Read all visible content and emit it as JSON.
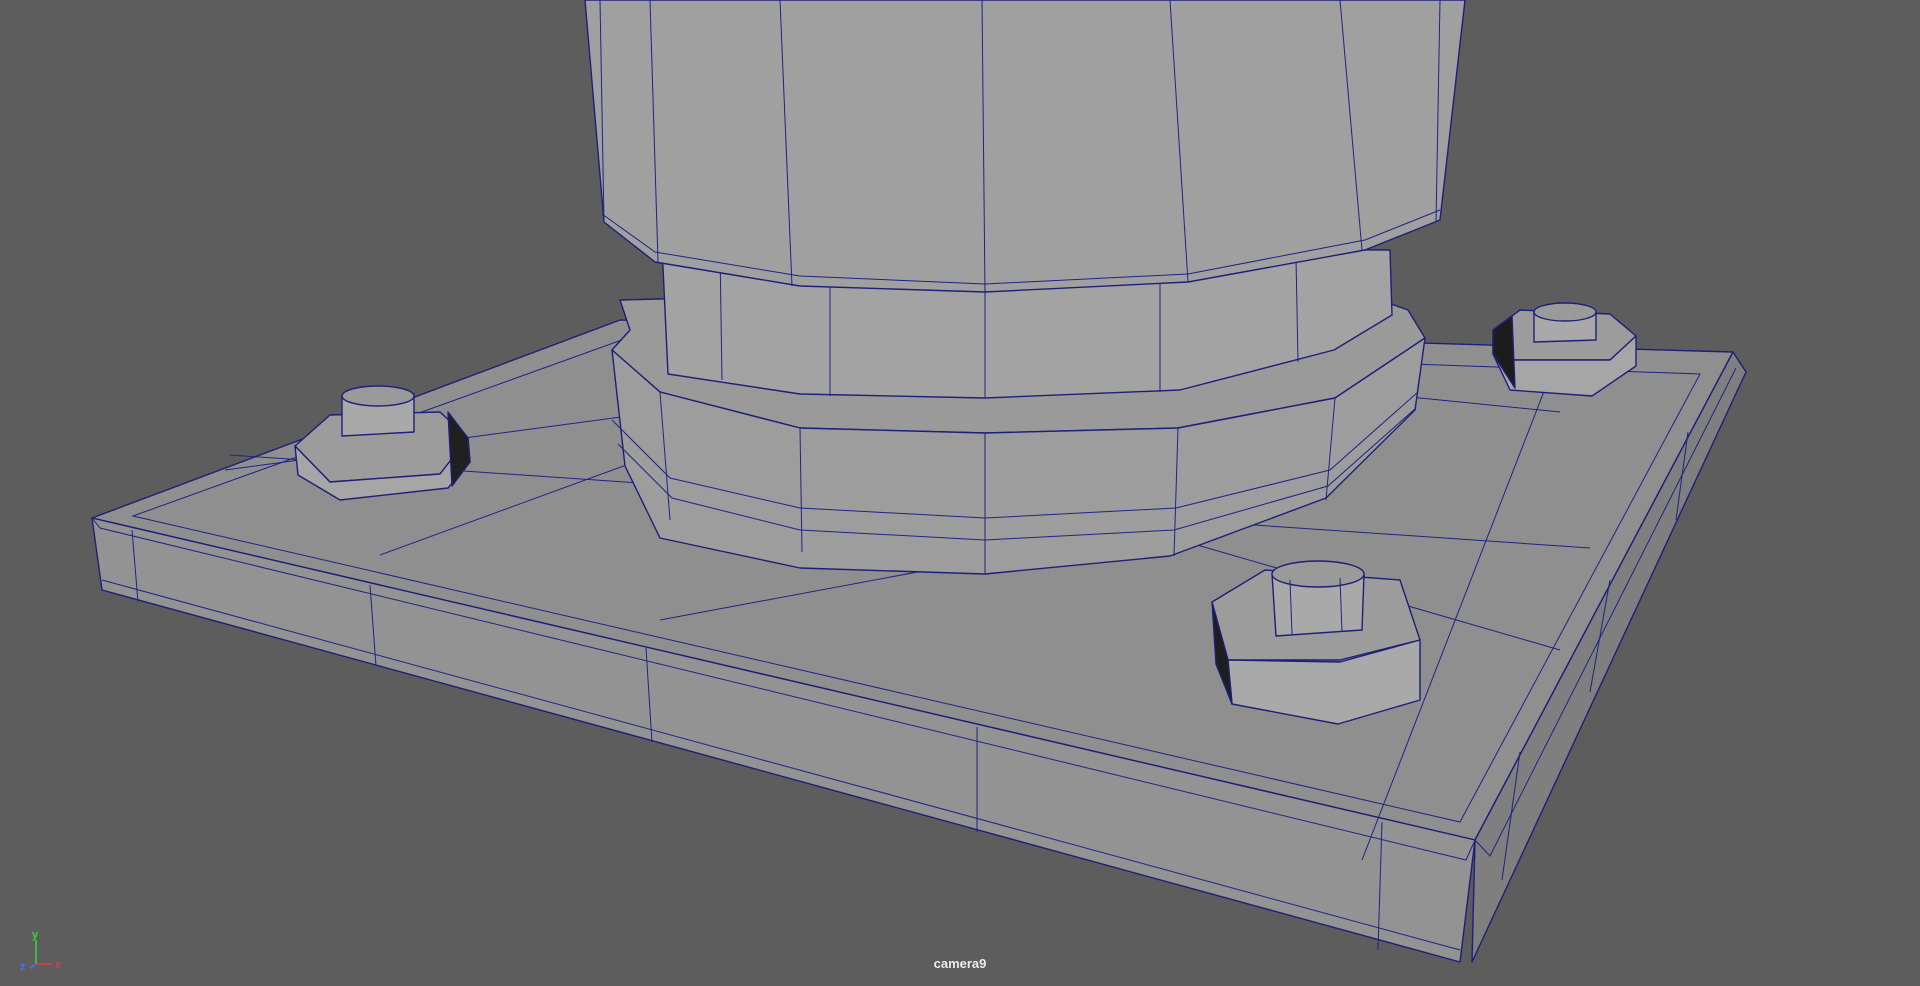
{
  "viewport": {
    "camera_name": "camera9",
    "background_color": "#5d5d5d",
    "wireframe_color": "#1d1f7a"
  },
  "axis_gizmo": {
    "y_label": "y",
    "x_label": "x",
    "z_label": "z",
    "y_color": "#3cd43c",
    "x_color": "#e03c3c",
    "z_color": "#4a6cff"
  }
}
